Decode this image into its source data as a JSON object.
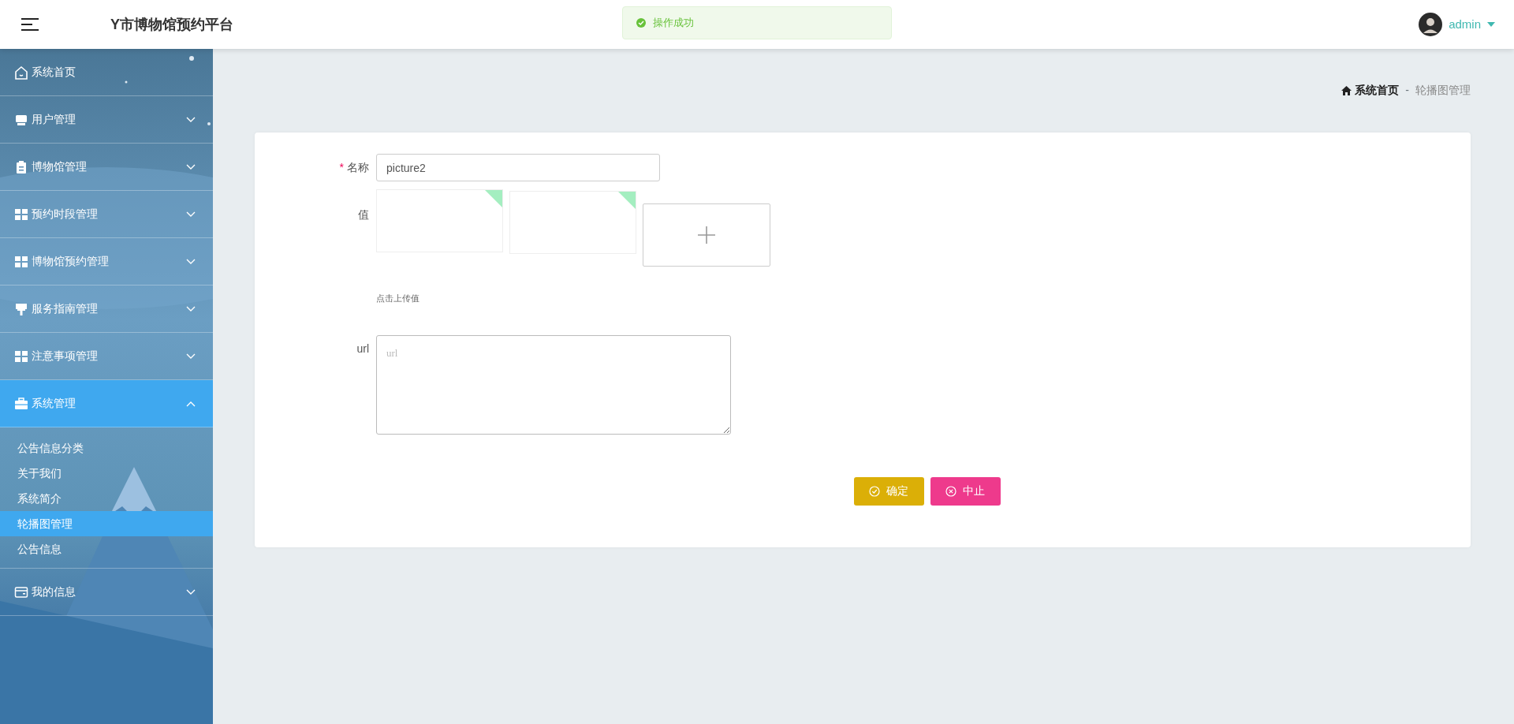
{
  "header": {
    "title": "Y市博物馆预约平台",
    "user": "admin"
  },
  "toast": {
    "kind": "success",
    "message": "操作成功"
  },
  "sidebar": {
    "items": [
      {
        "label": "系统首页",
        "kind": "home",
        "selected": false
      },
      {
        "label": "用户管理",
        "kind": "display",
        "expanded": false,
        "selected": false
      },
      {
        "label": "博物馆管理",
        "kind": "clipboard",
        "expanded": false,
        "selected": false
      },
      {
        "label": "预约时段管理",
        "kind": "grid",
        "expanded": false,
        "selected": false
      },
      {
        "label": "博物馆预约管理",
        "kind": "grid",
        "expanded": false,
        "selected": false
      },
      {
        "label": "服务指南管理",
        "kind": "roller",
        "expanded": false,
        "selected": false
      },
      {
        "label": "注意事项管理",
        "kind": "grid",
        "expanded": false,
        "selected": false
      },
      {
        "label": "系统管理",
        "kind": "briefcase",
        "expanded": true,
        "selected": true,
        "children": [
          {
            "label": "公告信息分类",
            "selected": false
          },
          {
            "label": "关于我们",
            "selected": false
          },
          {
            "label": "系统简介",
            "selected": false
          },
          {
            "label": "轮播图管理",
            "selected": true
          },
          {
            "label": "公告信息",
            "selected": false
          }
        ]
      },
      {
        "label": "我的信息",
        "kind": "wallet",
        "expanded": false,
        "selected": false
      }
    ]
  },
  "breadcrumb": {
    "items": [
      {
        "label": "系统首页",
        "kind": "home"
      },
      {
        "label": "轮播图管理",
        "kind": "current"
      }
    ],
    "separator": "-"
  },
  "form": {
    "fields": [
      {
        "kind": "text",
        "label": "名称",
        "required_mark": "*",
        "value": "picture2"
      },
      {
        "kind": "upload",
        "label": "值",
        "hint": "点击上传值"
      },
      {
        "kind": "textarea",
        "label": "url",
        "placeholder": "url"
      }
    ],
    "buttons": [
      {
        "kind": "confirm",
        "label": "确定"
      },
      {
        "kind": "cancel",
        "label": "中止"
      }
    ]
  }
}
